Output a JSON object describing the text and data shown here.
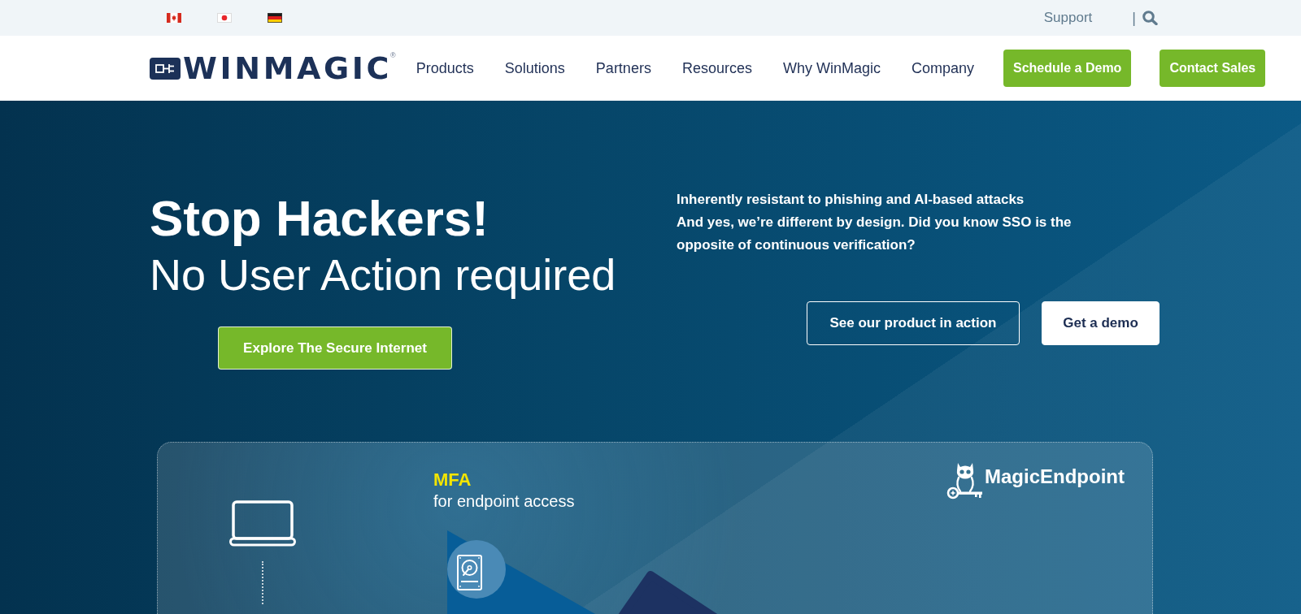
{
  "top_bar": {
    "support_link": "Support",
    "separator": "|"
  },
  "header": {
    "logo": {
      "wordmark": "WINMAGIC",
      "registered_mark": "®"
    },
    "menu": [
      "Products",
      "Solutions",
      "Partners",
      "Resources",
      "Why WinMagic",
      "Company"
    ],
    "buttons": [
      "Schedule a Demo",
      "Contact Sales"
    ]
  },
  "hero": {
    "title": "Stop Hackers!",
    "subtitle": "No User Action required",
    "primary_button": "Explore The Secure Internet",
    "intro_heading": "Inherently resistant to phishing and AI-based attacks",
    "intro_text": "And yes, we’re different by design. Did you know SSO is the opposite of continuous verification?",
    "buttons": [
      {
        "label": "See our product in action",
        "kind": "outline"
      },
      {
        "label": "Get a demo",
        "kind": "solid"
      }
    ]
  },
  "feature_card": {
    "tag": "MFA",
    "caption": "for endpoint access",
    "brand": "MagicEndpoint"
  }
}
